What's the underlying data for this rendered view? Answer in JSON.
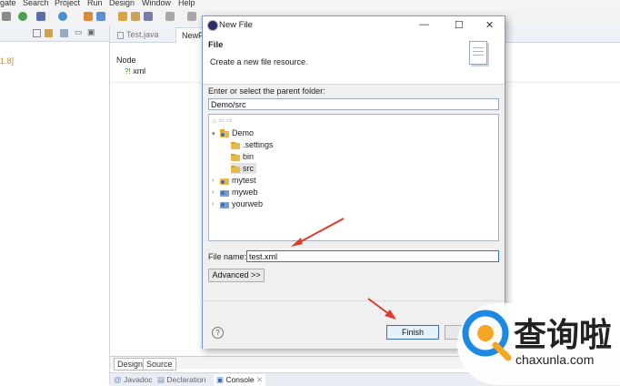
{
  "menu": [
    "gate",
    "Search",
    "Project",
    "Run",
    "Design",
    "Window",
    "Help"
  ],
  "left_panel": {
    "version_text": "1.8]"
  },
  "editor": {
    "tabs": [
      "Test.java",
      "NewF"
    ],
    "outline_header": "Node",
    "outline_item": "xml",
    "design_tab": "Design",
    "source_tab": "Source",
    "bottom_tabs": [
      "Javadoc",
      "Declaration",
      "Console"
    ]
  },
  "dialog": {
    "title": "New File",
    "heading": "File",
    "description": "Create a new file resource.",
    "parent_label": "Enter or select the parent folder:",
    "parent_value": "Demo/src",
    "tree": [
      {
        "label": "Demo"
      },
      {
        "label": ".settings"
      },
      {
        "label": "bin"
      },
      {
        "label": "src"
      },
      {
        "label": "mytest"
      },
      {
        "label": "myweb"
      },
      {
        "label": "yourweb"
      }
    ],
    "filename_label": "File name:",
    "filename_value": "test.xml",
    "advanced_button": "Advanced >>",
    "finish_button": "Finish",
    "help_icon_glyph": "?"
  },
  "watermark": {
    "brand_cn": "查询啦",
    "domain": "chaxunla.com"
  },
  "colors": {
    "accent_blue": "#3d6fb5",
    "arrow_red": "#e03a2f",
    "folder": "#e7b94a",
    "watermark_blue": "#1e88e5"
  }
}
